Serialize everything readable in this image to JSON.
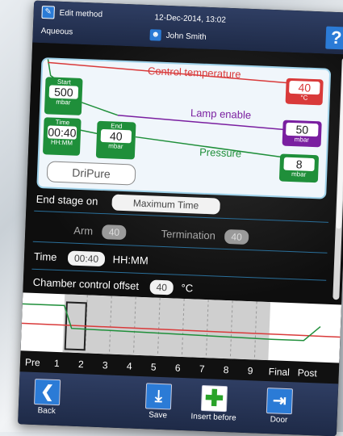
{
  "header": {
    "title": "Edit method",
    "datetime": "12-Dec-2014, 13:02",
    "method_name": "Aqueous",
    "user": "John Smith",
    "help_label": "?"
  },
  "diagram": {
    "control_temperature_label": "Control temperature",
    "control_temperature_value": "40",
    "control_temperature_unit": "°C",
    "lamp_enable_label": "Lamp enable",
    "lamp_enable_value": "50",
    "lamp_enable_unit": "mbar",
    "pressure_label": "Pressure",
    "pressure_value": "8",
    "pressure_unit": "mbar",
    "start_label": "Start",
    "start_value": "500",
    "start_unit": "mbar",
    "time_label": "Time",
    "time_value": "00:40",
    "time_unit": "HH:MM",
    "end_label": "End",
    "end_value": "40",
    "end_unit": "mbar",
    "dripure_label": "DriPure",
    "colors": {
      "temperature": "#d93a3a",
      "lamp": "#7a1fa0",
      "pressure": "#1f8f3a"
    }
  },
  "settings": {
    "end_stage_label": "End stage on",
    "end_stage_value": "Maximum Time",
    "arm_label": "Arm",
    "arm_value": "40",
    "termination_label": "Termination",
    "termination_value": "40",
    "time_label": "Time",
    "time_value": "00:40",
    "time_unit": "HH:MM",
    "chamber_offset_label": "Chamber control offset",
    "chamber_offset_value": "40",
    "chamber_offset_unit": "°C"
  },
  "timeline": {
    "stages": [
      "Pre",
      "1",
      "2",
      "3",
      "4",
      "5",
      "6",
      "7",
      "8",
      "9",
      "Final",
      "Post"
    ],
    "selected_stage": "1"
  },
  "toolbar": {
    "back_label": "Back",
    "save_label": "Save",
    "insert_before_label": "Insert before",
    "door_label": "Door"
  }
}
